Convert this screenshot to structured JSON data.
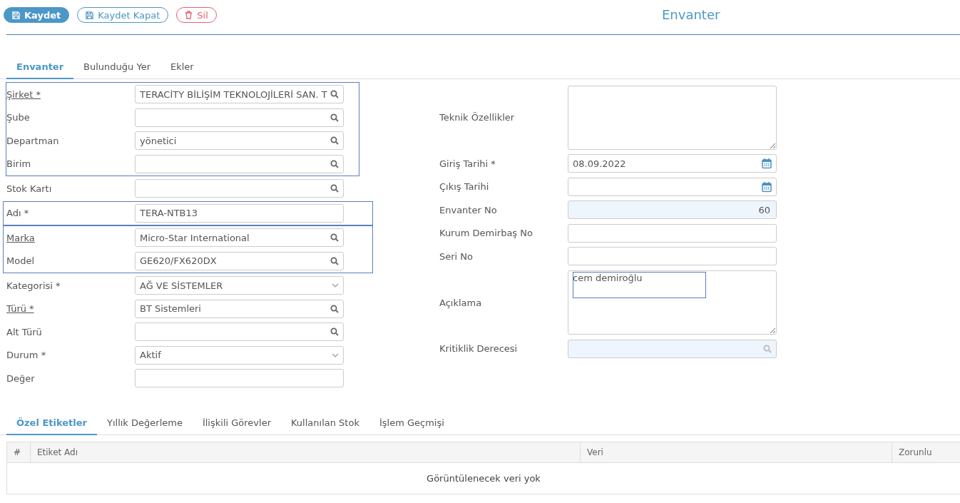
{
  "toolbar": {
    "buttons": [
      {
        "label": "Kaydet",
        "kind": "primary"
      },
      {
        "label": "Kaydet Kapat",
        "kind": "outline"
      },
      {
        "label": "Sil",
        "kind": "danger"
      }
    ]
  },
  "page_title": "Envanter",
  "tabs": [
    {
      "label": "Envanter",
      "selected": true
    },
    {
      "label": "Bulunduğu Yer",
      "selected": false
    },
    {
      "label": "Ekler",
      "selected": false
    }
  ],
  "form": {
    "left_groups": [
      {
        "highlighted": true,
        "fields": [
          {
            "label": "Şirket *",
            "link": true,
            "kind": "lookup",
            "value": "TERACİTY BİLİŞİM TEKNOLOJİLERİ SAN. T"
          },
          {
            "label": "Şube",
            "link": false,
            "kind": "lookup"
          },
          {
            "label": "Departman",
            "link": false,
            "kind": "lookup",
            "value": "yönetici"
          },
          {
            "label": "Birim",
            "link": false,
            "kind": "lookup"
          }
        ]
      },
      {
        "highlighted": false,
        "fields": [
          {
            "label": "Stok Kartı",
            "link": false,
            "kind": "lookup"
          }
        ]
      },
      {
        "highlighted": true,
        "fields": [
          {
            "label": "Adı *",
            "link": false,
            "kind": "text",
            "value": "TERA-NTB13"
          }
        ]
      },
      {
        "highlighted": true,
        "fields": [
          {
            "label": "Marka",
            "link": true,
            "kind": "lookup",
            "value": "Micro-Star International"
          },
          {
            "label": "Model",
            "link": false,
            "kind": "lookup",
            "value": "GE620/FX620DX"
          }
        ]
      },
      {
        "highlighted": false,
        "fields": [
          {
            "label": "Kategorisi *",
            "link": false,
            "kind": "select",
            "value": "AĞ VE SİSTEMLER"
          },
          {
            "label": "Türü *",
            "link": true,
            "kind": "lookup",
            "value": "BT Sistemleri"
          },
          {
            "label": "Alt Türü",
            "link": false,
            "kind": "lookup"
          },
          {
            "label": "Durum *",
            "link": false,
            "kind": "select",
            "value": "Aktif"
          },
          {
            "label": "Değer",
            "link": false,
            "kind": "text"
          }
        ]
      }
    ],
    "right_fields": [
      {
        "label": "Teknik Özellikler",
        "kind": "textarea",
        "disabled": false,
        "highlighted": false
      },
      {
        "label": "Giriş Tarihi *",
        "kind": "date",
        "value": "08.09.2022",
        "disabled": false,
        "highlighted": false
      },
      {
        "label": "Çıkış Tarihi",
        "kind": "date",
        "disabled": false,
        "highlighted": false
      },
      {
        "label": "Envanter No",
        "kind": "number",
        "value": "60",
        "disabled": true,
        "highlighted": false
      },
      {
        "label": "Kurum Demirbaş No",
        "kind": "text",
        "disabled": false,
        "highlighted": false
      },
      {
        "label": "Seri No",
        "kind": "text",
        "disabled": false,
        "highlighted": false
      },
      {
        "label": "Açıklama",
        "kind": "textarea",
        "value": "cem demiroğlu",
        "disabled": false,
        "highlighted": true
      },
      {
        "label": "Kritiklik Derecesi",
        "kind": "lookup",
        "disabled": true,
        "highlighted": false
      }
    ]
  },
  "detail_tabs": [
    {
      "label": "Özel Etiketler",
      "selected": true
    },
    {
      "label": "Yıllık Değerleme",
      "selected": false
    },
    {
      "label": "İlişkili Görevler",
      "selected": false
    },
    {
      "label": "Kullanılan Stok",
      "selected": false
    },
    {
      "label": "İşlem Geçmişi",
      "selected": false
    }
  ],
  "table": {
    "columns": [
      "#",
      "Etiket Adı",
      "Veri",
      "Zorunlu"
    ],
    "empty_message": "Görüntülenecek veri yok"
  }
}
